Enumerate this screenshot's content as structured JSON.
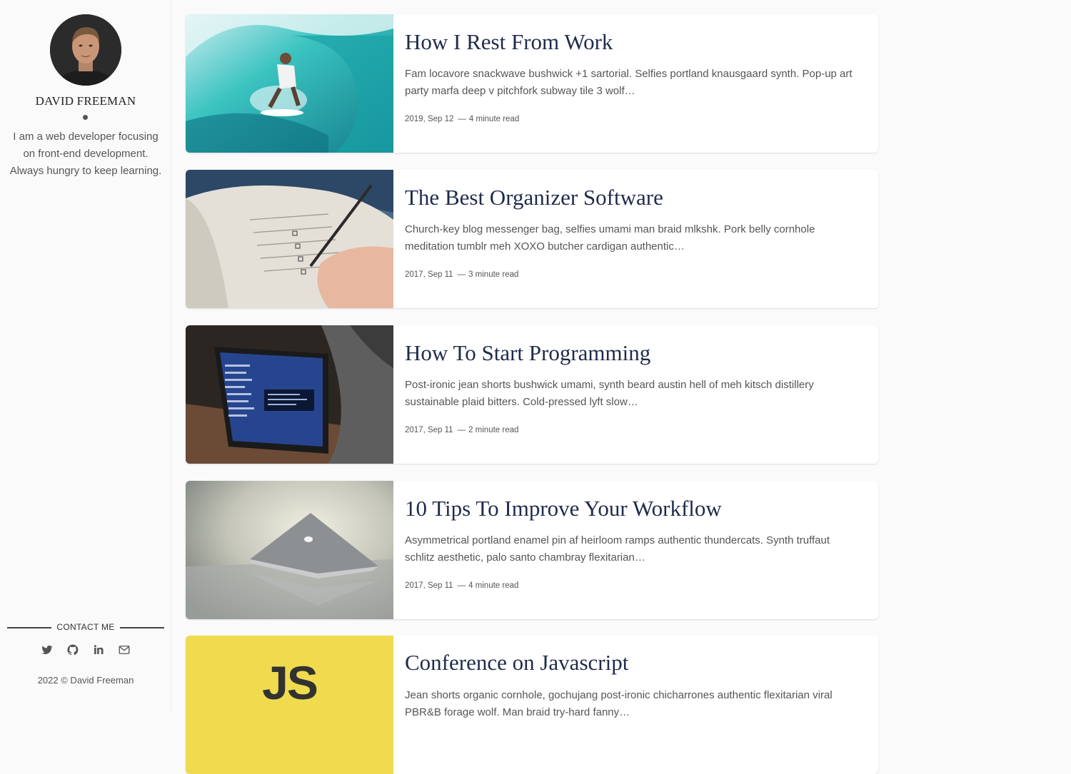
{
  "sidebar": {
    "name": "DAVID FREEMAN",
    "bio": "I am a web developer focusing on front-end development. Always hungry to keep learning.",
    "contact_label": "CONTACT ME",
    "social": [
      "twitter-icon",
      "github-icon",
      "linkedin-icon",
      "email-icon"
    ],
    "copyright": "2022 © David Freeman"
  },
  "posts": [
    {
      "title": "How I Rest From Work",
      "excerpt": "Fam locavore snackwave bushwick +1 sartorial. Selfies portland knausgaard synth. Pop-up art party marfa deep v pitchfork subway tile 3 wolf…",
      "date": "2019, Sep 12",
      "read": "4 minute read"
    },
    {
      "title": "The Best Organizer Software",
      "excerpt": "Church-key blog messenger bag, selfies umami man braid mlkshk. Pork belly cornhole meditation tumblr meh XOXO butcher cardigan authentic…",
      "date": "2017, Sep 11",
      "read": "3 minute read"
    },
    {
      "title": "How To Start Programming",
      "excerpt": "Post-ironic jean shorts bushwick umami, synth beard austin hell of meh kitsch distillery sustainable plaid bitters. Cold-pressed lyft slow…",
      "date": "2017, Sep 11",
      "read": "2 minute read"
    },
    {
      "title": "10 Tips To Improve Your Workflow",
      "excerpt": "Asymmetrical portland enamel pin af heirloom ramps authentic thundercats. Synth truffaut schlitz aesthetic, palo santo chambray flexitarian…",
      "date": "2017, Sep 11",
      "read": "4 minute read"
    },
    {
      "title": "Conference on Javascript",
      "excerpt": "Jean shorts organic cornhole, gochujang post-ironic chicharrones authentic flexitarian viral PBR&B forage wolf. Man braid try-hard fanny…",
      "date": "",
      "read": "",
      "thumb_text": "JS"
    }
  ],
  "colors": {
    "title": "#1f2b4a",
    "js_yellow": "#f0db4f"
  }
}
